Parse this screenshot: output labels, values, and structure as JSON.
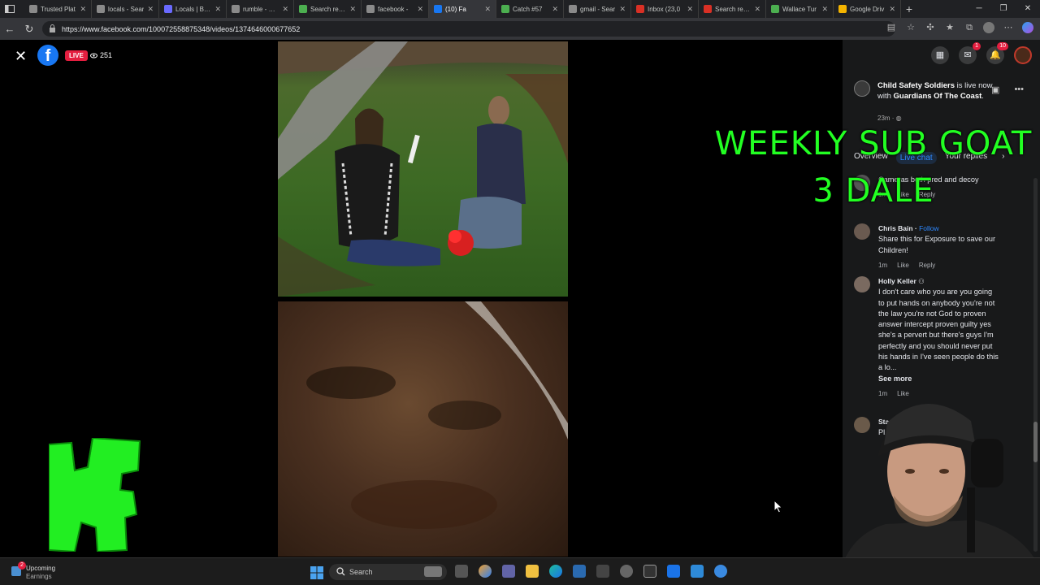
{
  "browser": {
    "tabs": [
      {
        "title": "Trusted Plat",
        "color": "#8a8a8a"
      },
      {
        "title": "locals - Sear",
        "color": "#8a8a8a"
      },
      {
        "title": "Locals | Bike",
        "color": "#6a6aff"
      },
      {
        "title": "rumble - Sea",
        "color": "#8a8a8a"
      },
      {
        "title": "Search resul",
        "color": "#4caf50"
      },
      {
        "title": "facebook -",
        "color": "#8a8a8a"
      },
      {
        "title": "(10) Fa",
        "color": "#1877f2"
      },
      {
        "title": "Catch #57",
        "color": "#4caf50"
      },
      {
        "title": "gmail - Sear",
        "color": "#8a8a8a"
      },
      {
        "title": "Inbox (23,0",
        "color": "#d93025"
      },
      {
        "title": "Search resul",
        "color": "#d93025"
      },
      {
        "title": "Wallace Tur",
        "color": "#4caf50"
      },
      {
        "title": "Google Driv",
        "color": "#f4b400"
      }
    ],
    "url": "https://www.facebook.com/100072558875348/videos/1374646000677652"
  },
  "viewer": {
    "live_label": "LIVE",
    "viewer_count": "251"
  },
  "sidebar": {
    "messenger_count": "1",
    "notif_count": "10",
    "post": {
      "channel": "Child Safety Soldiers",
      "live_text": " is live now with ",
      "partner": "Guardians Of The Coast",
      "suffix": ".",
      "time": "23m"
    },
    "tabs": [
      "Overview",
      "Live chat",
      "Your replies"
    ],
    "active_tab": "Live chat",
    "comments": [
      {
        "name": "",
        "text": "Cameras both pred and decoy",
        "time": "1m",
        "like": "Like",
        "reply": "Reply"
      },
      {
        "name": "Chris Bain",
        "follow": "Follow",
        "text": "Share this for Exposure to save our Children!",
        "time": "1m",
        "like": "Like",
        "reply": "Reply"
      },
      {
        "name": "Holly Keller",
        "text": "I don't care who you are you going to put hands on anybody you're not the law you're not God to proven answer intercept proven guilty yes she's a pervert but there's guys I'm perfectly and you should never put his hands in I've seen people do this a lo...",
        "see_more": "See more",
        "time": "1m",
        "like": "Like"
      },
      {
        "name": "Sta",
        "text": "Pl... man. Im g...",
        "time": "",
        "like": ""
      }
    ]
  },
  "overlay": {
    "line1": "WEEKLY SUB GOAT",
    "line2": "3 DALE",
    "color": "#22ff22"
  },
  "taskbar": {
    "weather_count": "2",
    "weather_title": "Upcoming",
    "weather_sub": "Earnings",
    "search_placeholder": "Search"
  }
}
